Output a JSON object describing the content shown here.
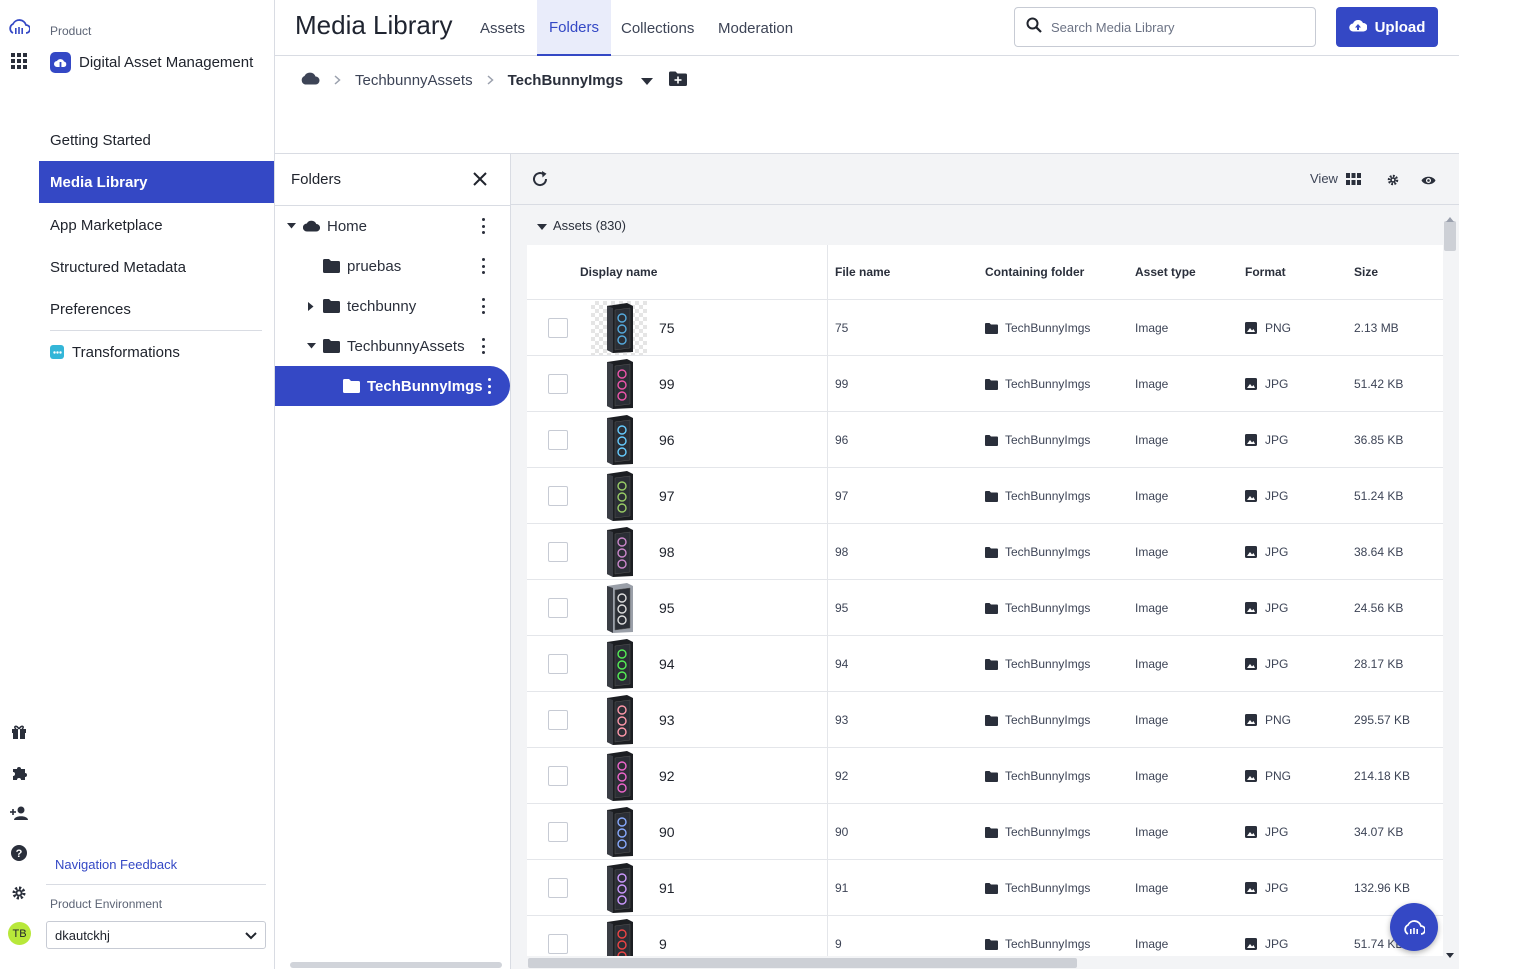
{
  "app": {
    "rail_icons": [
      "cloudinary-logo-icon",
      "apps-grid-icon",
      "gift-icon",
      "puzzle-icon",
      "add-user-icon",
      "help-icon",
      "settings-icon"
    ],
    "avatar_initials": "TB"
  },
  "sidebar": {
    "product_label": "Product",
    "product_name": "Digital Asset Management",
    "items": [
      {
        "label": "Getting Started",
        "active": false
      },
      {
        "label": "Media Library",
        "active": true
      },
      {
        "label": "App Marketplace",
        "active": false
      },
      {
        "label": "Structured Metadata",
        "active": false
      },
      {
        "label": "Preferences",
        "active": false
      },
      {
        "label": "Transformations",
        "active": false
      }
    ],
    "feedback": "Navigation Feedback",
    "env_label": "Product Environment",
    "env_value": "dkautckhj"
  },
  "header": {
    "title": "Media Library",
    "tabs": [
      {
        "label": "Assets",
        "active": false
      },
      {
        "label": "Folders",
        "active": true
      },
      {
        "label": "Collections",
        "active": false
      },
      {
        "label": "Moderation",
        "active": false
      }
    ],
    "search_placeholder": "Search Media Library",
    "upload_label": "Upload"
  },
  "breadcrumb": {
    "items": [
      "TechbunnyAssets"
    ],
    "current": "TechBunnyImgs"
  },
  "folders": {
    "title": "Folders",
    "tree": [
      {
        "label": "Home",
        "level": 0,
        "expanded": true,
        "icon": "cloud-icon"
      },
      {
        "label": "pruebas",
        "level": 1,
        "expanded": null,
        "icon": "folder-icon"
      },
      {
        "label": "techbunny",
        "level": 1,
        "expanded": false,
        "icon": "folder-icon"
      },
      {
        "label": "TechbunnyAssets",
        "level": 1,
        "expanded": true,
        "icon": "folder-icon"
      },
      {
        "label": "TechBunnyImgs",
        "level": 2,
        "expanded": null,
        "icon": "folder-icon",
        "active": true
      }
    ]
  },
  "main": {
    "view_label": "View",
    "assets_label": "Assets (830)",
    "columns": [
      "Display name",
      "File name",
      "Containing folder",
      "Asset type",
      "Format",
      "Size"
    ],
    "rows": [
      {
        "display": "75",
        "file": "75",
        "folder": "TechBunnyImgs",
        "type": "Image",
        "format": "PNG",
        "size": "2.13 MB"
      },
      {
        "display": "99",
        "file": "99",
        "folder": "TechBunnyImgs",
        "type": "Image",
        "format": "JPG",
        "size": "51.42 KB"
      },
      {
        "display": "96",
        "file": "96",
        "folder": "TechBunnyImgs",
        "type": "Image",
        "format": "JPG",
        "size": "36.85 KB"
      },
      {
        "display": "97",
        "file": "97",
        "folder": "TechBunnyImgs",
        "type": "Image",
        "format": "JPG",
        "size": "51.24 KB"
      },
      {
        "display": "98",
        "file": "98",
        "folder": "TechBunnyImgs",
        "type": "Image",
        "format": "JPG",
        "size": "38.64 KB"
      },
      {
        "display": "95",
        "file": "95",
        "folder": "TechBunnyImgs",
        "type": "Image",
        "format": "JPG",
        "size": "24.56 KB"
      },
      {
        "display": "94",
        "file": "94",
        "folder": "TechBunnyImgs",
        "type": "Image",
        "format": "JPG",
        "size": "28.17 KB"
      },
      {
        "display": "93",
        "file": "93",
        "folder": "TechBunnyImgs",
        "type": "Image",
        "format": "PNG",
        "size": "295.57 KB"
      },
      {
        "display": "92",
        "file": "92",
        "folder": "TechBunnyImgs",
        "type": "Image",
        "format": "PNG",
        "size": "214.18 KB"
      },
      {
        "display": "90",
        "file": "90",
        "folder": "TechBunnyImgs",
        "type": "Image",
        "format": "JPG",
        "size": "34.07 KB"
      },
      {
        "display": "91",
        "file": "91",
        "folder": "TechBunnyImgs",
        "type": "Image",
        "format": "JPG",
        "size": "132.96 KB"
      },
      {
        "display": "9",
        "file": "9",
        "folder": "TechBunnyImgs",
        "type": "Image",
        "format": "JPG",
        "size": "51.74 KB"
      }
    ]
  },
  "colors": {
    "accent": "#3448c5",
    "active_tab_bg": "#e9ecfa",
    "avatar": "#b8e83a"
  }
}
